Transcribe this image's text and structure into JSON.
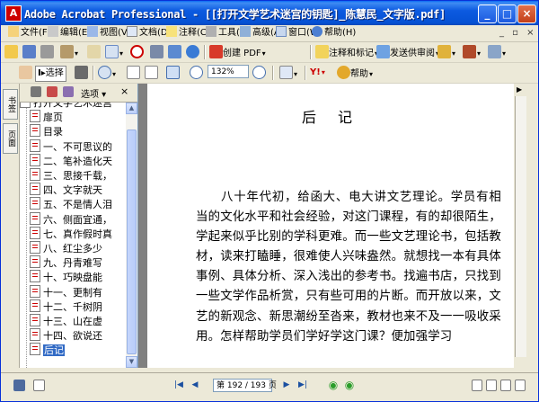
{
  "window": {
    "title": "Adobe Acrobat Professional - [[打开文学艺术迷宫的钥匙]_陈慧民_文字版.pdf]",
    "controls": {
      "minimize": "_",
      "maximize": "□",
      "close": "×"
    }
  },
  "menubar": {
    "items": [
      {
        "label": "文件(F)",
        "icon": "file-menu-icon"
      },
      {
        "label": "编辑(E)",
        "icon": "edit-menu-icon"
      },
      {
        "label": "视图(V)",
        "icon": "view-menu-icon"
      },
      {
        "label": "文档(D)",
        "icon": "document-menu-icon"
      },
      {
        "label": "注释(C)",
        "icon": "comment-menu-icon"
      },
      {
        "label": "工具(T)",
        "icon": "tools-menu-icon"
      },
      {
        "label": "高级(A)",
        "icon": "advanced-menu-icon"
      },
      {
        "label": "窗口(W)",
        "icon": "window-menu-icon"
      },
      {
        "label": "帮助(H)",
        "icon": "help-menu-icon"
      }
    ],
    "doc_controls": "_ ▫ ×"
  },
  "toolbar1": {
    "create_pdf": "创建 PDF",
    "review_comment": "注释和标记",
    "send_review": "发送供审阅"
  },
  "toolbar2": {
    "select_tool": "选择",
    "zoom": "132%",
    "help": "帮助"
  },
  "nav": {
    "tab_bookmarks": "书签",
    "tab_pages": "页面",
    "options": "选项",
    "close": "×",
    "bookmarks": [
      "打开文学艺术迷宫",
      "扉页",
      "目录",
      "一、不可思议的",
      "二、笔补造化天",
      "三、思接千载，",
      "四、文字就天",
      "五、不是情人泪",
      "六、侧面宜通，",
      "七、真作假时真",
      "八、红尘多少",
      "九、丹青难写",
      "十、巧映盘能",
      "十一、更制有",
      "十二、千树阴",
      "十三、山在虚",
      "十四、欲说还",
      "后记"
    ],
    "selected_index": 17
  },
  "document": {
    "heading": "后记",
    "paragraph": "八十年代初，给函大、电大讲文艺理论。学员有相当的文化水平和社会经验，对这门课程，有的却很陌生，学起来似乎比别的学科更难。而一些文艺理论书，包括教材，读来打瞌睡，很难使人兴味盎然。就想找一本有具体事例、具体分析、深入浅出的参考书。找遍书店，只找到一些文学作品析赏，只有些可用的片断。而开放以来，文艺的新观念、新思潮纷至沓来，教材也来不及一一吸收采用。怎样帮助学员们学好学这门课？便加强学习"
  },
  "status": {
    "page_label": "第 192 / 193 页"
  },
  "colors": {
    "titlebar": "#0551d4",
    "chrome": "#ece9d8",
    "selection": "#316ac5",
    "pdf_red": "#cc0000"
  }
}
